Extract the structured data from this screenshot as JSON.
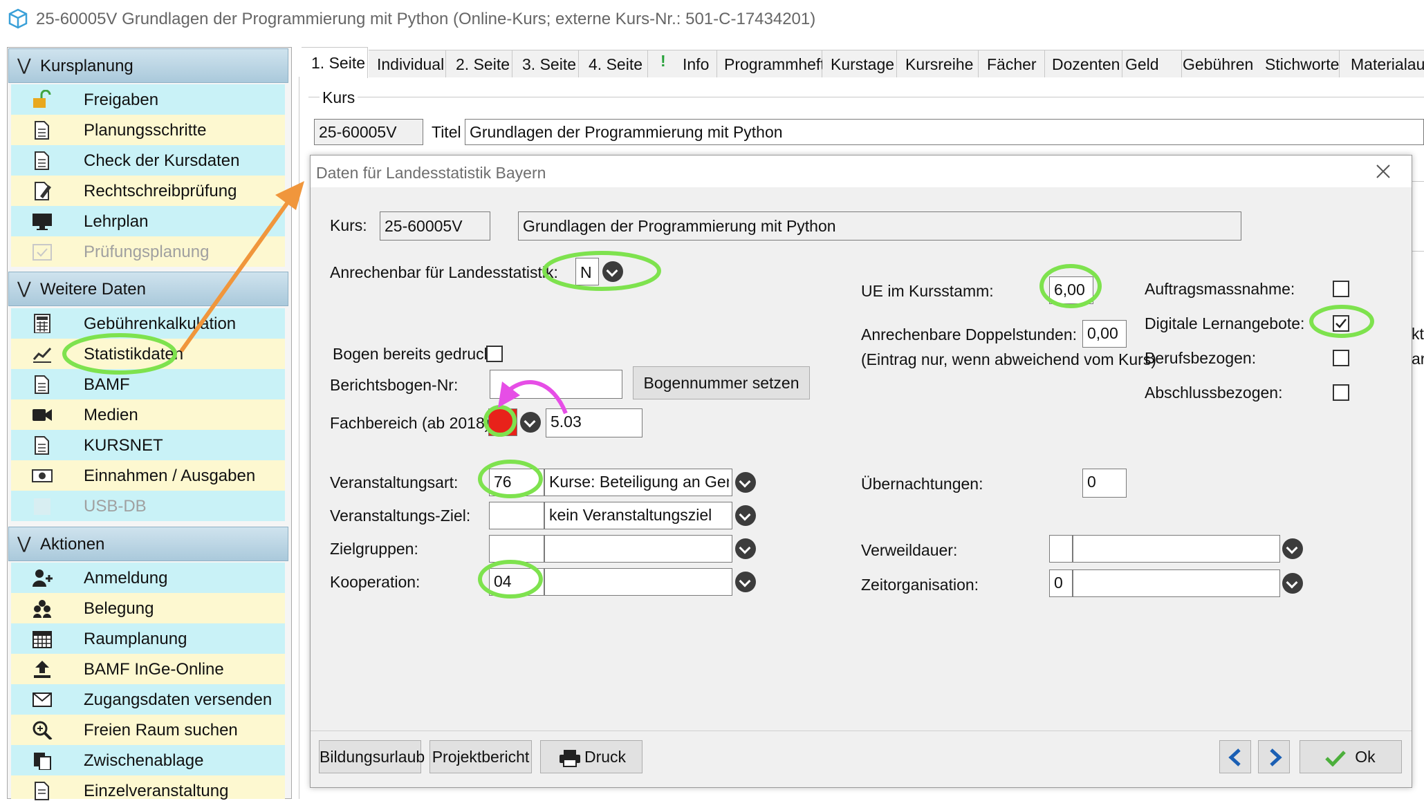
{
  "window": {
    "title": "25-60005V Grundlagen der Programmierung mit Python (Online-Kurs; externe Kurs-Nr.: 501-C-17434201)"
  },
  "sidebar": {
    "sections": [
      {
        "title": "Kursplanung",
        "items": [
          {
            "label": "Freigaben",
            "icon": "unlock-icon"
          },
          {
            "label": "Planungsschritte",
            "icon": "document-icon"
          },
          {
            "label": "Check der Kursdaten",
            "icon": "document-icon"
          },
          {
            "label": "Rechtschreibprüfung",
            "icon": "edit-document-icon"
          },
          {
            "label": "Lehrplan",
            "icon": "monitor-icon"
          },
          {
            "label": "Prüfungsplanung",
            "icon": "calendar-check-icon"
          }
        ]
      },
      {
        "title": "Weitere Daten",
        "items": [
          {
            "label": "Gebührenkalkulation",
            "icon": "calculator-icon"
          },
          {
            "label": "Statistikdaten",
            "icon": "chart-line-icon"
          },
          {
            "label": "BAMF",
            "icon": "document-icon"
          },
          {
            "label": "Medien",
            "icon": "video-camera-icon"
          },
          {
            "label": "KURSNET",
            "icon": "document-icon"
          },
          {
            "label": "Einnahmen / Ausgaben",
            "icon": "money-icon"
          },
          {
            "label": "USB-DB",
            "icon": "database-icon"
          }
        ]
      },
      {
        "title": "Aktionen",
        "items": [
          {
            "label": "Anmeldung",
            "icon": "add-user-icon"
          },
          {
            "label": "Belegung",
            "icon": "users-icon"
          },
          {
            "label": "Raumplanung",
            "icon": "calendar-grid-icon"
          },
          {
            "label": "BAMF InGe-Online",
            "icon": "upload-icon"
          },
          {
            "label": "Zugangsdaten versenden",
            "icon": "envelope-icon"
          },
          {
            "label": "Freien Raum suchen",
            "icon": "magnifier-icon"
          },
          {
            "label": "Zwischenablage",
            "icon": "clipboard-icon"
          },
          {
            "label": "Einzelveranstaltung",
            "icon": "document-icon"
          }
        ]
      }
    ]
  },
  "tabs": [
    "1. Seite",
    "Individual",
    "2. Seite",
    "3. Seite",
    "4. Seite",
    "!",
    "Info",
    "Programmheft",
    "Kurstage",
    "Kursreihe",
    "Fächer",
    "Dozenten",
    "Geld",
    "Gebühren",
    "Stichworte",
    "Materialaus"
  ],
  "kurs_group": {
    "label": "Kurs",
    "number": "25-60005V",
    "title_label": "Titel",
    "title_value": "Grundlagen der Programmierung mit Python"
  },
  "background_right_fragments": [
    "kt",
    "ar"
  ],
  "dialog": {
    "title": "Daten für Landesstatistik Bayern",
    "kurs_label": "Kurs:",
    "kurs_number": "25-60005V",
    "kurs_title": "Grundlagen der Programmierung mit Python",
    "anrechenbar_label": "Anrechenbar für Landesstatistik:",
    "anrechenbar_value": "N",
    "ue_label": "UE im Kursstamm:",
    "ue_value": "6,00",
    "doppel_label": "Anrechenbare Doppelstunden:",
    "doppel_value": "0,00",
    "doppel_hint": "(Eintrag nur, wenn abweichend vom Kurs)",
    "auftrags_label": "Auftragsmassnahme:",
    "digitale_label": "Digitale Lernangebote:",
    "berufs_label": "Berufsbezogen:",
    "abschluss_label": "Abschlussbezogen:",
    "checks": {
      "auftrags": false,
      "digitale": true,
      "berufs": false,
      "abschluss": false
    },
    "bogen_gedruckt_label": "Bogen bereits gedruckt",
    "bogen_gedruckt_checked": false,
    "berichtsbogen_label": "Berichtsbogen-Nr:",
    "berichtsbogen_value": "",
    "bogennummer_button": "Bogennummer setzen",
    "fachbereich_label": "Fachbereich (ab 2018)",
    "fachbereich_color": "#e8221a",
    "fachbereich_value": "5.03",
    "veranstaltungsart_label": "Veranstaltungsart:",
    "veranstaltungsart_code": "76",
    "veranstaltungsart_text": "Kurse: Beteiligung an Gemeinschafts",
    "ziel_label": "Veranstaltungs-Ziel:",
    "ziel_code": "",
    "ziel_text": "kein Veranstaltungsziel",
    "zielgruppen_label": "Zielgruppen:",
    "zielgruppen_code": "",
    "zielgruppen_text": "",
    "kooperation_label": "Kooperation:",
    "kooperation_code": "04",
    "kooperation_text": "",
    "uebernachtungen_label": "Übernachtungen:",
    "uebernachtungen_value": "0",
    "verweildauer_label": "Verweildauer:",
    "verweildauer_code": "",
    "verweildauer_text": "",
    "zeitorg_label": "Zeitorganisation:",
    "zeitorg_code": "0",
    "zeitorg_text": "",
    "buttons": {
      "bildungsurlaub": "Bildungsurlaub",
      "projektbericht": "Projektbericht",
      "druck": "Druck",
      "ok": "Ok"
    }
  },
  "annotation_colors": {
    "green": "#7ee24e",
    "orange": "#f0963c",
    "magenta": "#e64ee6"
  }
}
